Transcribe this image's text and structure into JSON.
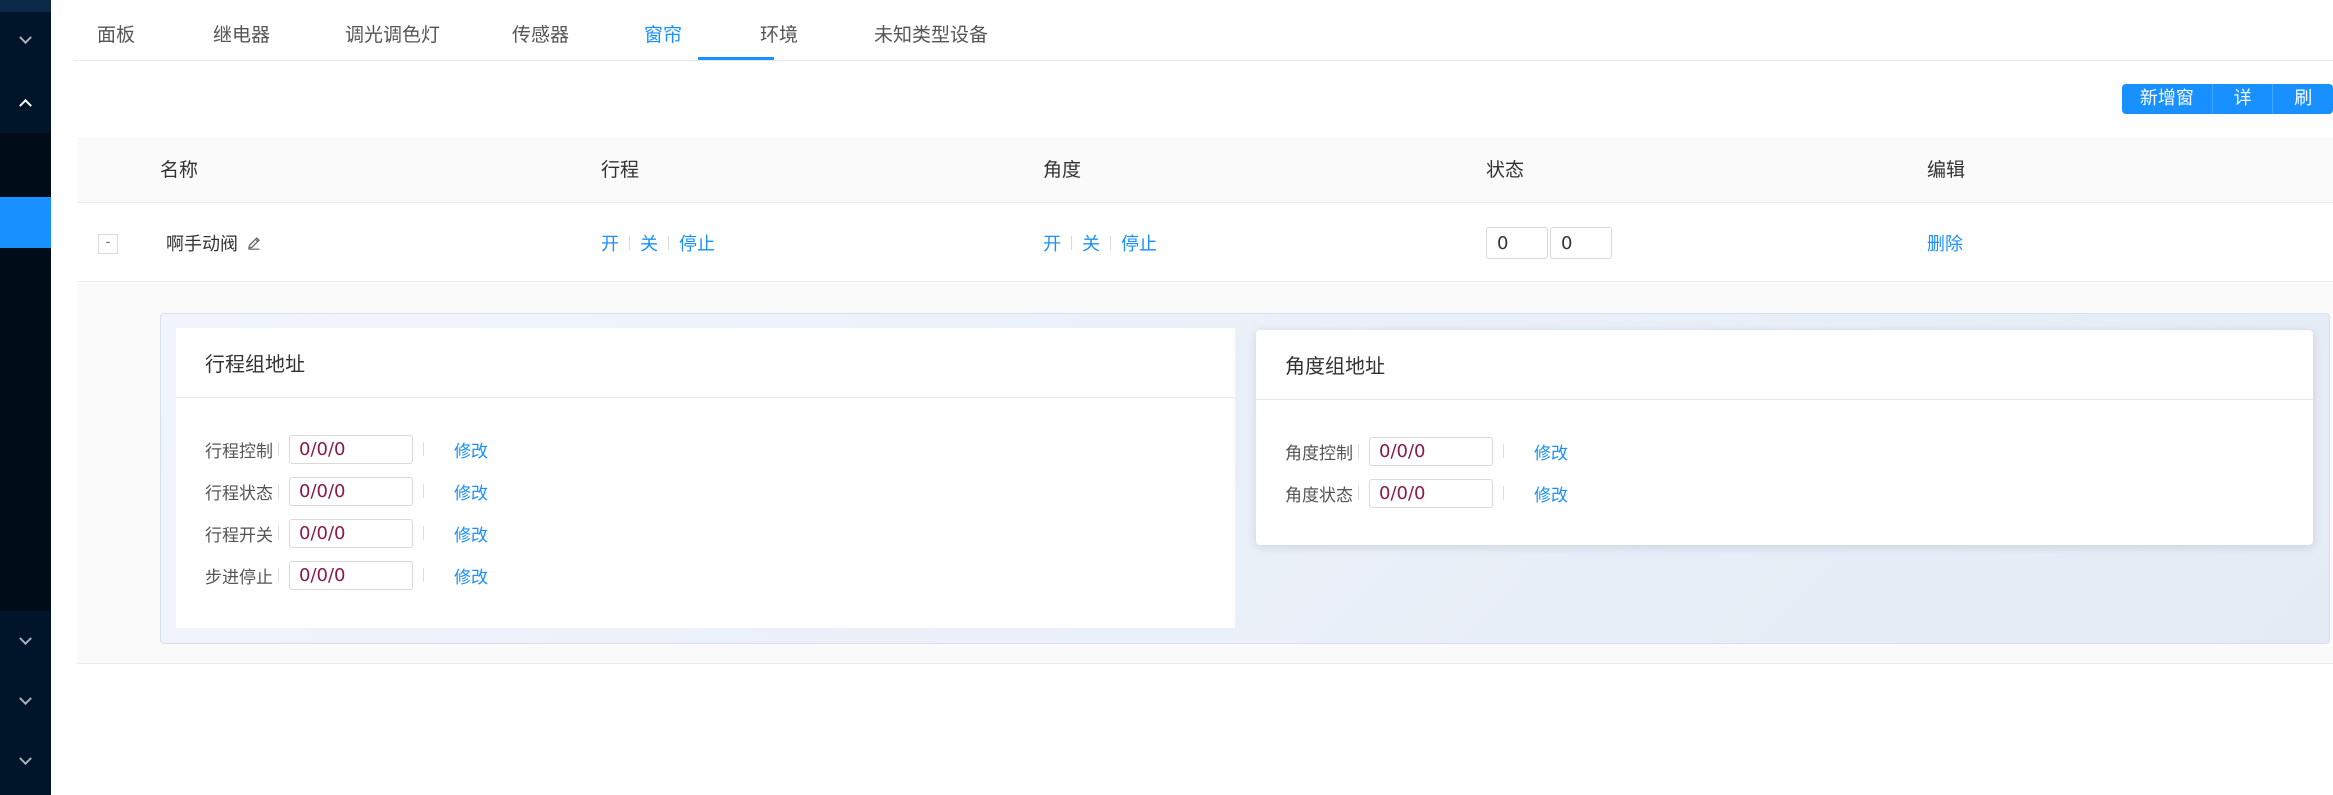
{
  "tabs": [
    {
      "label": "面板"
    },
    {
      "label": "继电器"
    },
    {
      "label": "调光调色灯"
    },
    {
      "label": "传感器"
    },
    {
      "label": "窗帘"
    },
    {
      "label": "环境"
    },
    {
      "label": "未知类型设备"
    }
  ],
  "active_tab": "窗帘",
  "toolbar": {
    "add_label": "新增窗帘",
    "detail_label": "详 情",
    "refresh_label": "刷 新"
  },
  "table": {
    "columns": [
      "名称",
      "行程",
      "角度",
      "状态",
      "编辑"
    ],
    "rows": [
      {
        "expand_symbol": "-",
        "name": "啊手动阀",
        "travel_actions": [
          "开",
          "关",
          "停止"
        ],
        "angle_actions": [
          "开",
          "关",
          "停止"
        ],
        "status_values": [
          "0",
          "0"
        ],
        "edit_action": "删除"
      }
    ]
  },
  "travel_group": {
    "title": "行程组地址",
    "rows": [
      {
        "label": "行程控制",
        "value": "0/0/0",
        "action": "修改"
      },
      {
        "label": "行程状态",
        "value": "0/0/0",
        "action": "修改"
      },
      {
        "label": "行程开关",
        "value": "0/0/0",
        "action": "修改"
      },
      {
        "label": "步进停止",
        "value": "0/0/0",
        "action": "修改"
      }
    ]
  },
  "angle_group": {
    "title": "角度组地址",
    "rows": [
      {
        "label": "角度控制",
        "value": "0/0/0",
        "action": "修改"
      },
      {
        "label": "角度状态",
        "value": "0/0/0",
        "action": "修改"
      }
    ]
  },
  "colors": {
    "sidebar_bg": "#001529",
    "accent": "#1890ff",
    "address_text": "#8a1a4a"
  },
  "icons": {
    "sidebar_chevrons": [
      "chevron-down-icon",
      "chevron-up-icon",
      "chevron-down-icon",
      "chevron-down-icon",
      "chevron-down-icon"
    ],
    "edit_name": "pencil-icon"
  }
}
